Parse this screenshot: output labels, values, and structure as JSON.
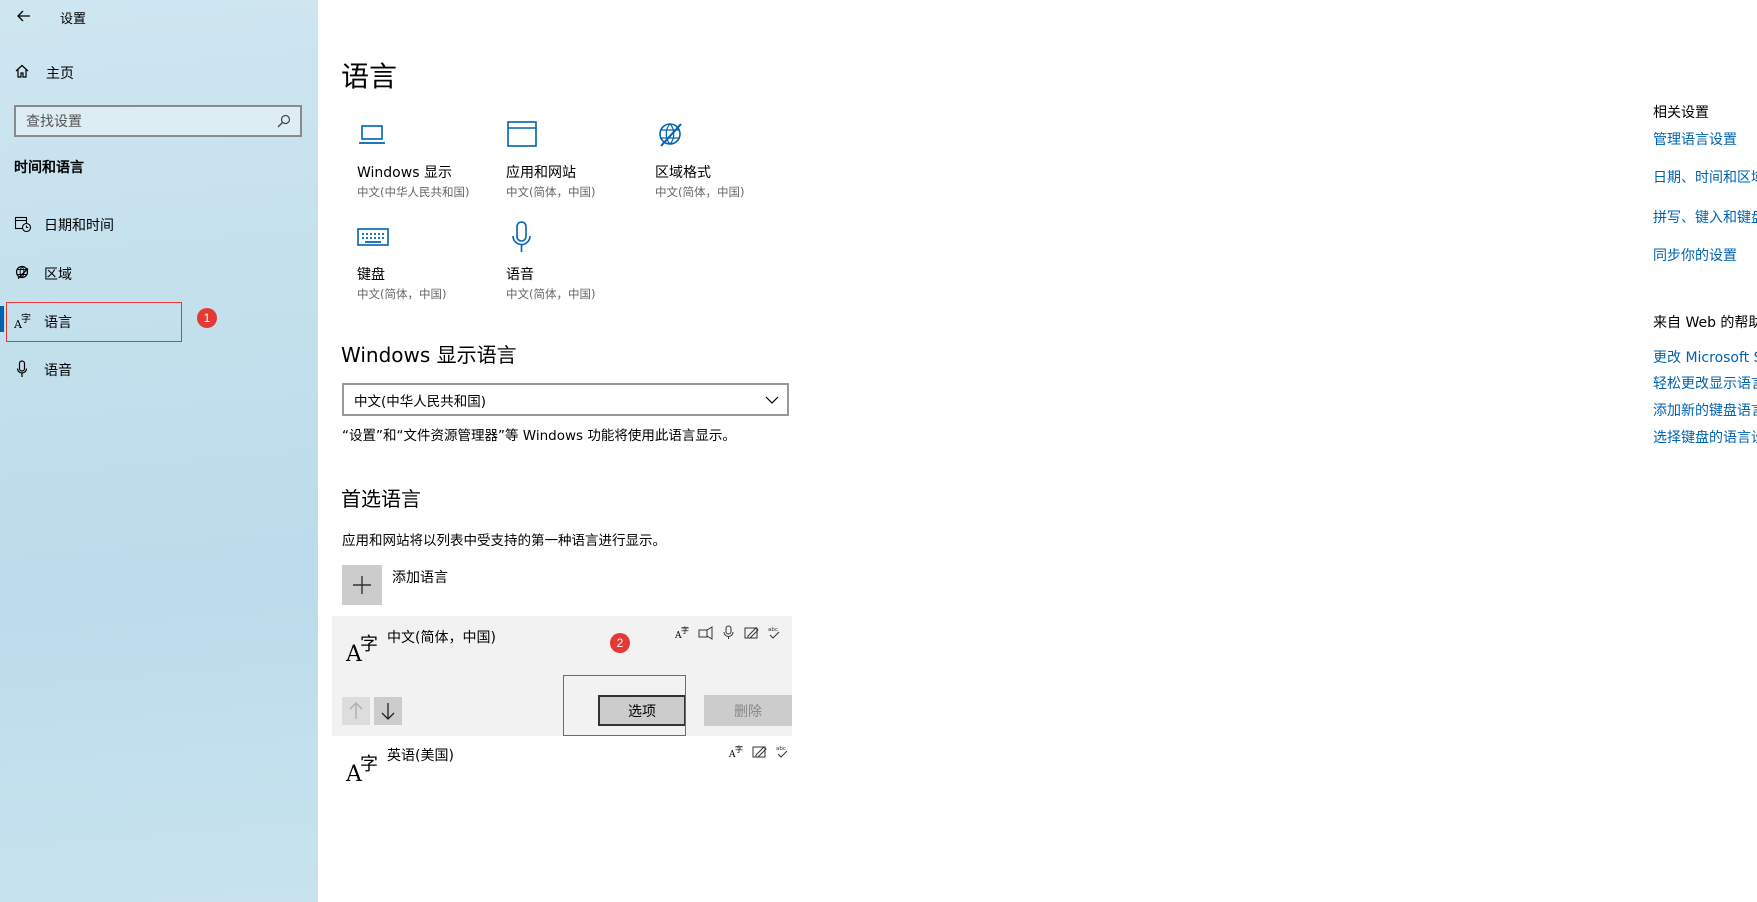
{
  "app": {
    "title": "设置"
  },
  "sidebar": {
    "home_label": "主页",
    "search_placeholder": "查找设置",
    "section_title": "时间和语言",
    "items": [
      {
        "label": "日期和时间",
        "icon": "calendar-clock-icon"
      },
      {
        "label": "区域",
        "icon": "globe-icon"
      },
      {
        "label": "语言",
        "icon": "language-icon",
        "selected": true
      },
      {
        "label": "语音",
        "icon": "microphone-icon"
      }
    ]
  },
  "annotations": {
    "one": "1",
    "two": "2",
    "color": "#e53935"
  },
  "main": {
    "title": "语言",
    "tiles": [
      {
        "title": "Windows 显示",
        "sub": "中文(中华人民共和国)",
        "icon": "laptop-icon"
      },
      {
        "title": "应用和网站",
        "sub": "中文(简体，中国)",
        "icon": "window-icon"
      },
      {
        "title": "区域格式",
        "sub": "中文(简体，中国)",
        "icon": "region-format-icon"
      },
      {
        "title": "键盘",
        "sub": "中文(简体，中国)",
        "icon": "keyboard-icon"
      },
      {
        "title": "语音",
        "sub": "中文(简体，中国)",
        "icon": "microphone-icon"
      }
    ],
    "display_language": {
      "heading": "Windows 显示语言",
      "selected": "中文(中华人民共和国)",
      "note": "“设置”和“文件资源管理器”等 Windows 功能将使用此语言显示。"
    },
    "preferred": {
      "heading": "首选语言",
      "note": "应用和网站将以列表中受支持的第一种语言进行显示。",
      "add_label": "添加语言",
      "languages": [
        {
          "name": "中文(简体，中国)",
          "glyph_a": "A",
          "glyph_b": "字",
          "options_label": "选项",
          "remove_label": "删除"
        },
        {
          "name": "英语(美国)",
          "glyph_a": "A",
          "glyph_b": "字"
        }
      ]
    },
    "accent_color": "#0063b1"
  },
  "related": {
    "header": "相关设置",
    "links": [
      "管理语言设置",
      "日期、时间和区域",
      "拼写、键入和键盘",
      "同步你的设置"
    ],
    "web_header": "来自 Web 的帮助",
    "web_links": [
      "更改 Microsoft Store",
      "轻松更改显示语言",
      "添加新的键盘语言",
      "选择键盘的语言设置"
    ]
  }
}
